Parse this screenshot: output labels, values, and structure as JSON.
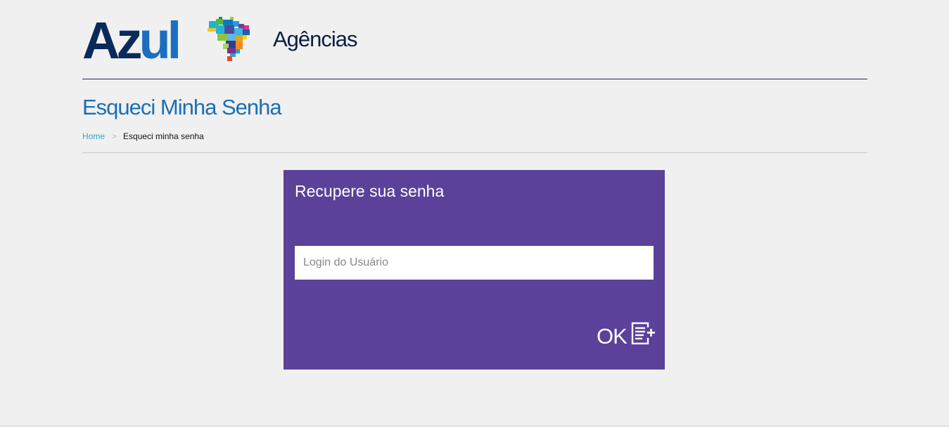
{
  "header": {
    "logo": {
      "text_main": "Az",
      "text_accent": "ul"
    },
    "app_name": "Agências"
  },
  "page": {
    "title": "Esqueci Minha Senha"
  },
  "breadcrumb": {
    "home": "Home",
    "separator": ">",
    "current": "Esqueci minha senha"
  },
  "recovery": {
    "title": "Recupere sua senha",
    "login_placeholder": "Login do Usuário",
    "login_value": "",
    "ok_label": "OK",
    "ok_icon": "form-add-icon"
  },
  "colors": {
    "brand_navy": "#0a2a5a",
    "brand_blue": "#1a6fc0",
    "title_blue": "#1a6fb5",
    "link_blue": "#2aa3d8",
    "panel_purple": "#5b4199",
    "background": "#f0f0f0"
  }
}
